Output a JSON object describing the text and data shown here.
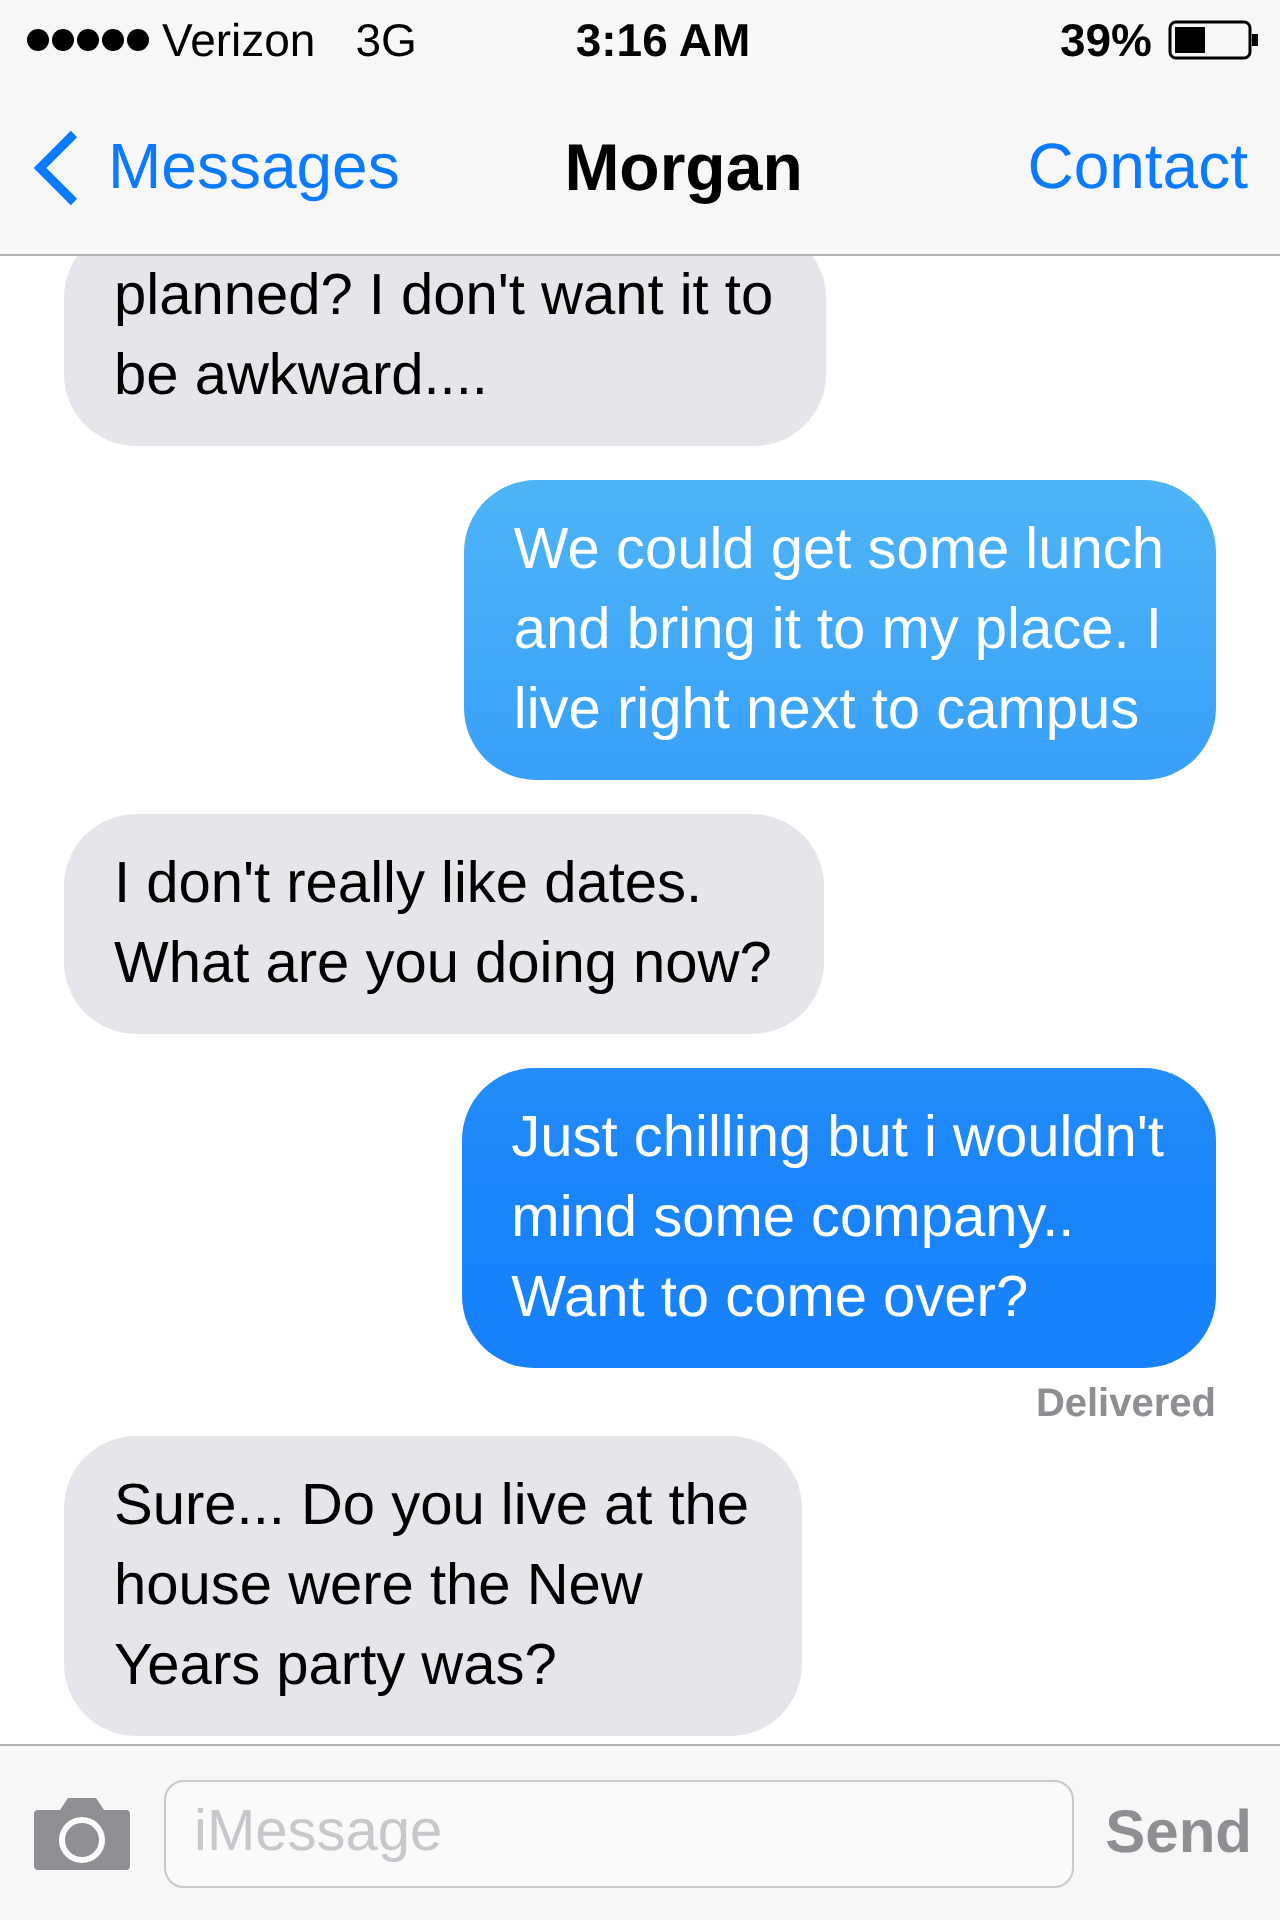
{
  "status_bar": {
    "carrier": "Verizon",
    "network": "3G",
    "time": "3:16 AM",
    "battery": "39%"
  },
  "nav": {
    "back": "Messages",
    "title": "Morgan",
    "action": "Contact"
  },
  "messages": [
    {
      "kind": "incoming",
      "text": "planned? I don't want it to\nbe awkward...."
    },
    {
      "kind": "outgoing",
      "text": "We could get some lunch\nand bring it to my place. I\nlive right next to campus"
    },
    {
      "kind": "incoming",
      "text": "I don't really like dates.\nWhat are you doing now?"
    },
    {
      "kind": "outgoing",
      "text": "Just chilling but i wouldn't\nmind some company..\nWant to come over?",
      "status": "Delivered"
    },
    {
      "kind": "incoming",
      "text": "Sure... Do you live at the\nhouse were the New\nYears party was?"
    }
  ],
  "input": {
    "placeholder": "iMessage",
    "send": "Send"
  }
}
